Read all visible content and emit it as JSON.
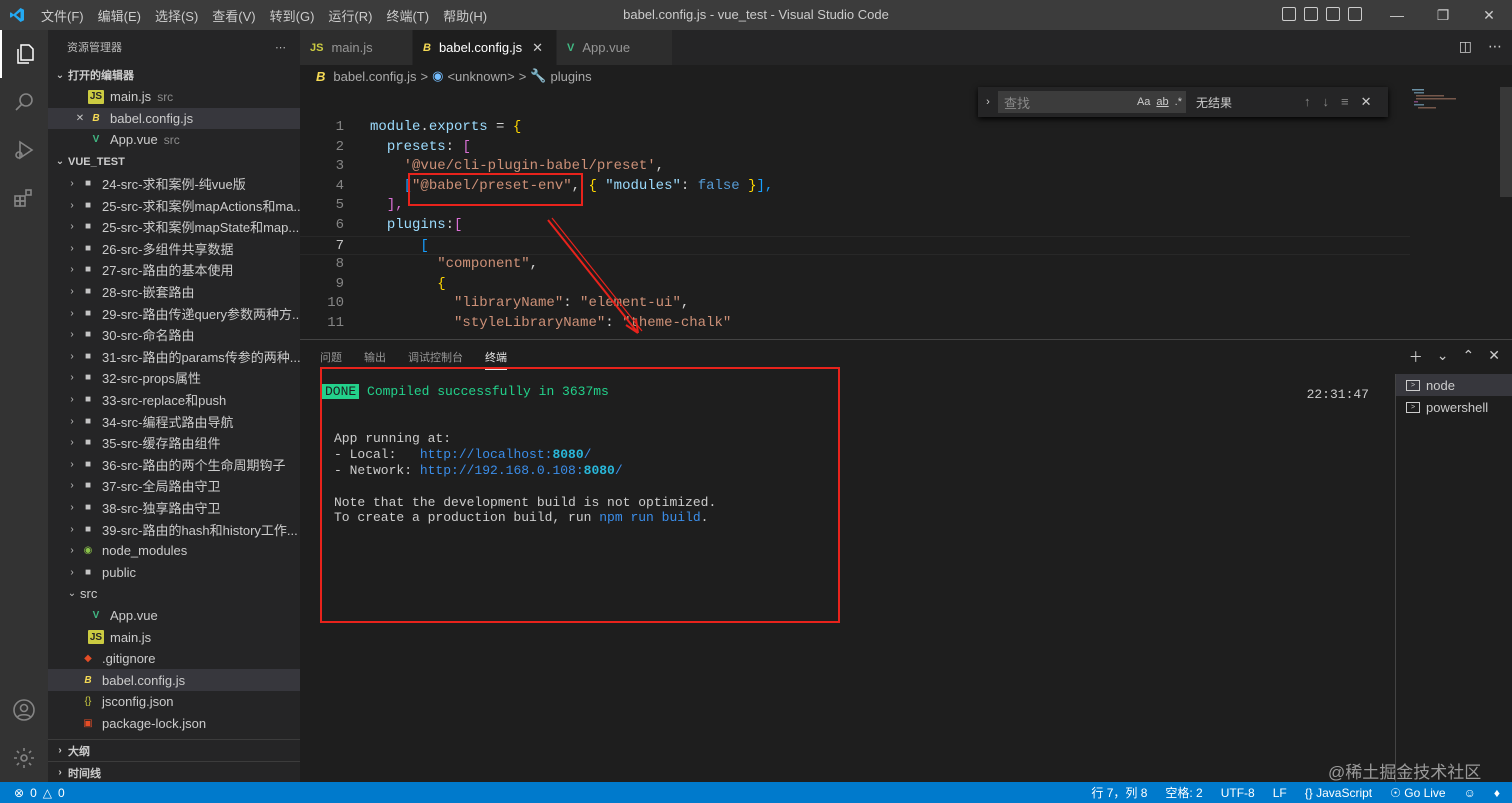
{
  "titlebar": {
    "menu": [
      "文件(F)",
      "编辑(E)",
      "选择(S)",
      "查看(V)",
      "转到(G)",
      "运行(R)",
      "终端(T)",
      "帮助(H)"
    ],
    "title": "babel.config.js - vue_test - Visual Studio Code"
  },
  "sidebar": {
    "header": "资源管理器",
    "open_editors_label": "打开的编辑器",
    "open_editors": [
      {
        "name": "main.js",
        "desc": "src",
        "icon": "js-icon"
      },
      {
        "name": "babel.config.js",
        "desc": "",
        "icon": "babel-icon"
      },
      {
        "name": "App.vue",
        "desc": "src",
        "icon": "vue-icon"
      }
    ],
    "project_label": "VUE_TEST",
    "folders": [
      "24-src-求和案例-纯vue版",
      "25-src-求和案例mapActions和ma...",
      "25-src-求和案例mapState和map...",
      "26-src-多组件共享数据",
      "27-src-路由的基本使用",
      "28-src-嵌套路由",
      "29-src-路由传递query参数两种方...",
      "30-src-命名路由",
      "31-src-路由的params传参的两种...",
      "32-src-props属性",
      "33-src-replace和push",
      "34-src-编程式路由导航",
      "35-src-缓存路由组件",
      "36-src-路由的两个生命周期钩子",
      "37-src-全局路由守卫",
      "38-src-独享路由守卫",
      "39-src-路由的hash和history工作..."
    ],
    "node_modules": "node_modules",
    "public": "public",
    "src": "src",
    "src_files": [
      "App.vue",
      "main.js"
    ],
    "root_files": [
      ".gitignore",
      "babel.config.js",
      "jsconfig.json",
      "package-lock.json"
    ],
    "outline_label": "大纲",
    "timeline_label": "时间线"
  },
  "tabs": [
    {
      "label": "main.js",
      "icon": "JS"
    },
    {
      "label": "babel.config.js",
      "icon": "B"
    },
    {
      "label": "App.vue",
      "icon": "V"
    }
  ],
  "breadcrumb": [
    "babel.config.js",
    ">",
    "<unknown>",
    ">",
    "plugins"
  ],
  "find": {
    "placeholder": "查找",
    "result": "无结果",
    "case": "Aa",
    "word": "ab",
    "regex": ".*"
  },
  "code": {
    "line_numbers": [
      "1",
      "2",
      "3",
      "4",
      "5",
      "6",
      "7",
      "8",
      "9",
      "10",
      "11"
    ],
    "l1a": "module",
    "l1b": ".",
    "l1c": "exports",
    "l1d": " = ",
    "l1e": "{",
    "l2a": "presets",
    "l2b": ": ",
    "l2c": "[",
    "l3a": "'@vue/cli-plugin-babel/preset'",
    "l3b": ",",
    "l4a": "[",
    "l4b": "\"@babel/preset-env\"",
    "l4c": ", ",
    "l4d": "{",
    "l4e": " \"modules\"",
    "l4f": ": ",
    "l4g": "false",
    "l4h": " }",
    "l4i": "],",
    "l5a": "],",
    "l6a": "plugins",
    "l6b": ":",
    "l6c": "[",
    "l7a": "[",
    "l8a": "\"component\"",
    "l8b": ",",
    "l9a": "{",
    "l10a": "\"libraryName\"",
    "l10b": ": ",
    "l10c": "\"element-ui\"",
    "l10d": ",",
    "l11a": "\"styleLibraryName\"",
    "l11b": ": ",
    "l11c": "\"theme-chalk\""
  },
  "panel": {
    "tabs": [
      "问题",
      "输出",
      "调试控制台",
      "终端"
    ],
    "done": "DONE",
    "compiled": " Compiled successfully in 3637ms",
    "time": "22:31:47",
    "app_running": "App running at:",
    "local_label": "- Local:   ",
    "local_url_a": "http://localhost:",
    "local_port": "8080",
    "local_url_b": "/",
    "network_label": "- Network: ",
    "network_url_a": "http://192.168.0.108:",
    "network_port": "8080",
    "network_url_b": "/",
    "note1": "Note that the development build is not optimized.",
    "note2a": "To create a production build, run ",
    "note2b": "npm run build",
    "note2c": ".",
    "terminals": [
      "node",
      "powershell"
    ]
  },
  "status": {
    "errors": "0",
    "warnings": "0",
    "position": "行 7，列 8",
    "spaces": "空格: 2",
    "encoding": "UTF-8",
    "eol": "LF",
    "language": "JavaScript",
    "golive": "Go Live"
  },
  "watermark": "@稀土掘金技术社区",
  "colors": {
    "accent": "#007acc",
    "annotation": "#e8231c",
    "done_bg": "#23d18b"
  }
}
